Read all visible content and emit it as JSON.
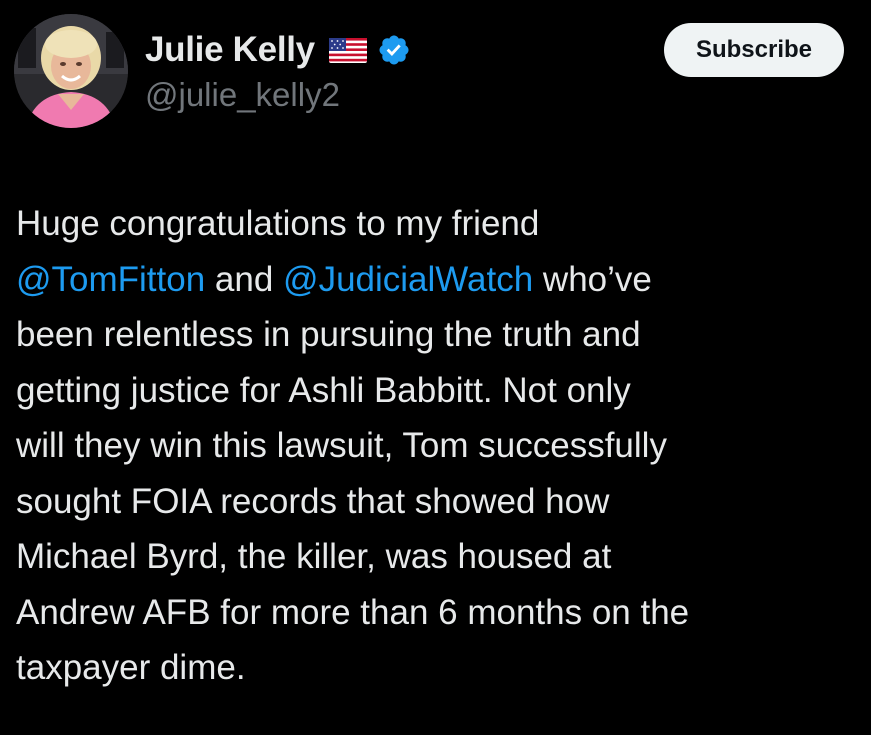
{
  "author": {
    "display_name": "Julie Kelly",
    "flag_emoji": "🇺🇸",
    "handle": "@julie_kelly2",
    "verified": true
  },
  "actions": {
    "subscribe_label": "Subscribe"
  },
  "tweet": {
    "lines": [
      {
        "segments": [
          {
            "text": "Huge congratulations to my friend",
            "type": "text"
          }
        ]
      },
      {
        "segments": [
          {
            "text": "@TomFitton",
            "type": "mention"
          },
          {
            "text": " and ",
            "type": "text"
          },
          {
            "text": "@JudicialWatch",
            "type": "mention"
          },
          {
            "text": " who’ve",
            "type": "text"
          }
        ]
      },
      {
        "segments": [
          {
            "text": "been relentless in pursuing the truth and",
            "type": "text"
          }
        ]
      },
      {
        "segments": [
          {
            "text": "getting justice for Ashli Babbitt. Not only",
            "type": "text"
          }
        ]
      },
      {
        "segments": [
          {
            "text": "will they win this lawsuit, Tom successfully",
            "type": "text"
          }
        ]
      },
      {
        "segments": [
          {
            "text": "sought FOIA records that showed how",
            "type": "text"
          }
        ]
      },
      {
        "segments": [
          {
            "text": "Michael Byrd, the killer, was housed at",
            "type": "text"
          }
        ]
      },
      {
        "segments": [
          {
            "text": "Andrew AFB for more than 6 months on the",
            "type": "text"
          }
        ]
      },
      {
        "segments": [
          {
            "text": "taxpayer dime.",
            "type": "text"
          }
        ]
      }
    ]
  },
  "colors": {
    "background": "#000000",
    "text_primary": "#e7e9ea",
    "text_secondary": "#71767b",
    "link": "#1d9bf0",
    "verified_badge": "#1d9bf0",
    "button_bg": "#eff3f4",
    "button_text": "#0f1419"
  },
  "icons": {
    "verified": "verified-badge-icon",
    "flag": "us-flag-icon"
  }
}
